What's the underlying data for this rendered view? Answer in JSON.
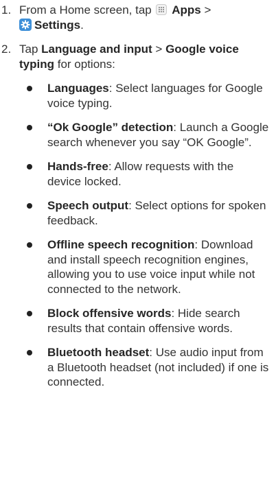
{
  "steps": [
    {
      "number": "1.",
      "prefix": "From a Home screen, tap",
      "apps_label": "Apps",
      "separator": ">",
      "settings_label": "Settings",
      "suffix": "."
    },
    {
      "number": "2.",
      "prefix": "Tap",
      "language_label": "Language and input",
      "separator": ">",
      "voice_label": "Google voice typing",
      "suffix": "for options:"
    }
  ],
  "options": [
    {
      "title": "Languages",
      "text": ": Select languages for Google voice typing."
    },
    {
      "title": "“Ok Google” detection",
      "text": ": Launch a Google search whenever you say “OK Google”."
    },
    {
      "title": "Hands-free",
      "text": ": Allow requests with the device locked."
    },
    {
      "title": "Speech output",
      "text": ": Select options for spoken feedback."
    },
    {
      "title": "Offline speech recognition",
      "text": ": Download and install speech recognition engines, allowing you to use voice input while not connected to the network."
    },
    {
      "title": "Block offensive words",
      "text": ": Hide search results that contain offensive words."
    },
    {
      "title": "Bluetooth headset",
      "text": ": Use audio input from a Bluetooth headset (not included) if one is connected."
    }
  ],
  "icons": {
    "apps": "apps-grid-icon",
    "settings": "settings-gear-icon",
    "settings_color": "#3d8fd8"
  }
}
